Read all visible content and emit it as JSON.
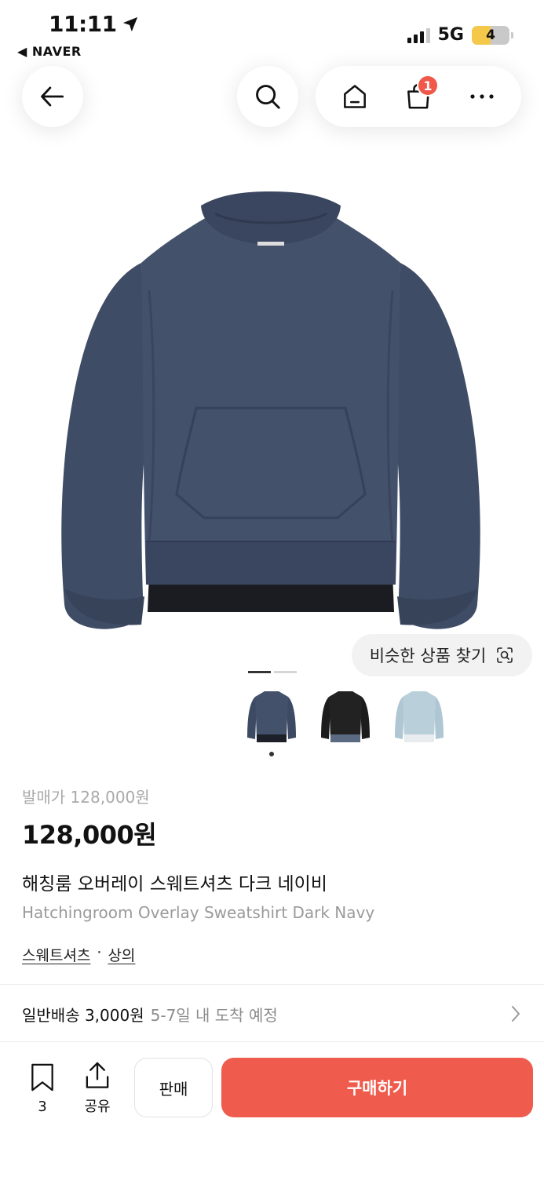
{
  "status_bar": {
    "time": "11:11",
    "back_app": "NAVER",
    "network": "5G",
    "battery": "4"
  },
  "header": {
    "cart_count": "1"
  },
  "product": {
    "similar_label": "비슷한 상품 찾기",
    "original_price": "발매가 128,000원",
    "price": "128,000원",
    "name_ko": "해칭룸 오버레이 스웨트셔츠 다크 네이비",
    "name_en": "Hatchingroom Overlay Sweatshirt Dark Navy",
    "categories": [
      "스웨트셔츠",
      "상의"
    ],
    "category_separator": "·",
    "color_variants": [
      {
        "icon": "navy-sweatshirt-thumb",
        "color": "#3d4a63",
        "selected": true
      },
      {
        "icon": "black-sweatshirt-thumb",
        "color": "#1f1f1f",
        "selected": false
      },
      {
        "icon": "lightblue-sweatshirt-thumb",
        "color": "#b9d0db",
        "selected": false
      }
    ]
  },
  "shipping": {
    "label": "일반배송 3,000원",
    "eta": "5-7일 내 도착 예정"
  },
  "bottom_bar": {
    "save_count": "3",
    "share_label": "공유",
    "sell_label": "판매",
    "buy_label": "구매하기"
  },
  "colors": {
    "accent": "#ef5b4c",
    "badge": "#f0584a",
    "product_navy": "#3d4a63"
  }
}
